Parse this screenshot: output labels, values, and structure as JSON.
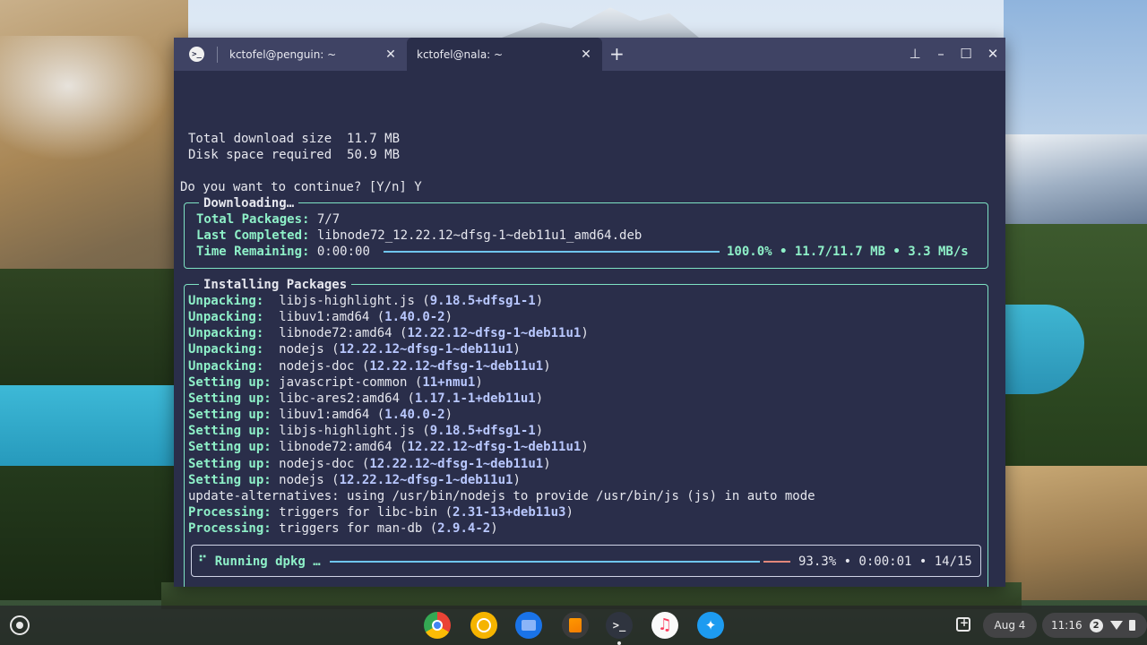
{
  "tabs": [
    {
      "title": "kctofel@penguin: ~"
    },
    {
      "title": "kctofel@nala: ~"
    }
  ],
  "tab_icon": ">_",
  "window_controls": {
    "pin": "pin-icon",
    "minimize": "minimize-icon",
    "maximize": "maximize-icon",
    "close": "close-icon"
  },
  "terminal": {
    "summary": [
      {
        "label": "Total download size",
        "value": "11.7 MB"
      },
      {
        "label": "Disk space required",
        "value": "50.9 MB"
      }
    ],
    "prompt": "Do you want to continue? [Y/n] Y",
    "download_box": {
      "title": "Downloading…",
      "total_packages_label": "Total Packages:",
      "total_packages": "7/7",
      "last_completed_label": "Last Completed:",
      "last_completed": "libnode72_12.22.12~dfsg-1~deb11u1_amd64.deb",
      "time_remaining_label": "Time Remaining:",
      "time_remaining": "0:00:00",
      "progress": 1.0,
      "stats": "100.0% • 11.7/11.7 MB • 3.3 MB/s"
    },
    "install_box": {
      "title": "Installing Packages",
      "lines": [
        {
          "action": "Unpacking:  ",
          "pkg": "libjs-highlight.js (",
          "ver": "9.18.5+dfsg1-1",
          "end": ")"
        },
        {
          "action": "Unpacking:  ",
          "pkg": "libuv1:amd64 (",
          "ver": "1.40.0-2",
          "end": ")"
        },
        {
          "action": "Unpacking:  ",
          "pkg": "libnode72:amd64 (",
          "ver": "12.22.12~dfsg-1~deb11u1",
          "end": ")"
        },
        {
          "action": "Unpacking:  ",
          "pkg": "nodejs (",
          "ver": "12.22.12~dfsg-1~deb11u1",
          "end": ")"
        },
        {
          "action": "Unpacking:  ",
          "pkg": "nodejs-doc (",
          "ver": "12.22.12~dfsg-1~deb11u1",
          "end": ")"
        },
        {
          "action": "Setting up: ",
          "pkg": "javascript-common (",
          "ver": "11+nmu1",
          "end": ")"
        },
        {
          "action": "Setting up: ",
          "pkg": "libc-ares2:amd64 (",
          "ver": "1.17.1-1+deb11u1",
          "end": ")"
        },
        {
          "action": "Setting up: ",
          "pkg": "libuv1:amd64 (",
          "ver": "1.40.0-2",
          "end": ")"
        },
        {
          "action": "Setting up: ",
          "pkg": "libjs-highlight.js (",
          "ver": "9.18.5+dfsg1-1",
          "end": ")"
        },
        {
          "action": "Setting up: ",
          "pkg": "libnode72:amd64 (",
          "ver": "12.22.12~dfsg-1~deb11u1",
          "end": ")"
        },
        {
          "action": "Setting up: ",
          "pkg": "nodejs-doc (",
          "ver": "12.22.12~dfsg-1~deb11u1",
          "end": ")"
        },
        {
          "action": "Setting up: ",
          "pkg": "nodejs (",
          "ver": "12.22.12~dfsg-1~deb11u1",
          "end": ")"
        },
        {
          "action": "",
          "pkg": "update-alternatives: using /usr/bin/nodejs to provide /usr/bin/js (js) in auto mode",
          "ver": "",
          "end": ""
        },
        {
          "action": "Processing: ",
          "pkg": "triggers for libc-bin (",
          "ver": "2.31-13+deb11u3",
          "end": ")"
        },
        {
          "action": "Processing: ",
          "pkg": "triggers for man-db (",
          "ver": "2.9.4-2",
          "end": ")"
        }
      ],
      "dpkg": {
        "spinner": "⠋",
        "label": "Running dpkg …",
        "progress": 0.933,
        "stats": "93.3% • 0:00:01 • 14/15"
      }
    }
  },
  "shelf": {
    "apps": [
      "chrome-icon",
      "keep-icon",
      "files-icon",
      "sublime-icon",
      "terminal-icon",
      "music-icon",
      "twitter-icon"
    ],
    "terminal_glyph": ">_",
    "music_glyph": "♫",
    "twitter_glyph": "🐦",
    "date": "Aug 4",
    "time": "11:16",
    "notifications": "2"
  }
}
